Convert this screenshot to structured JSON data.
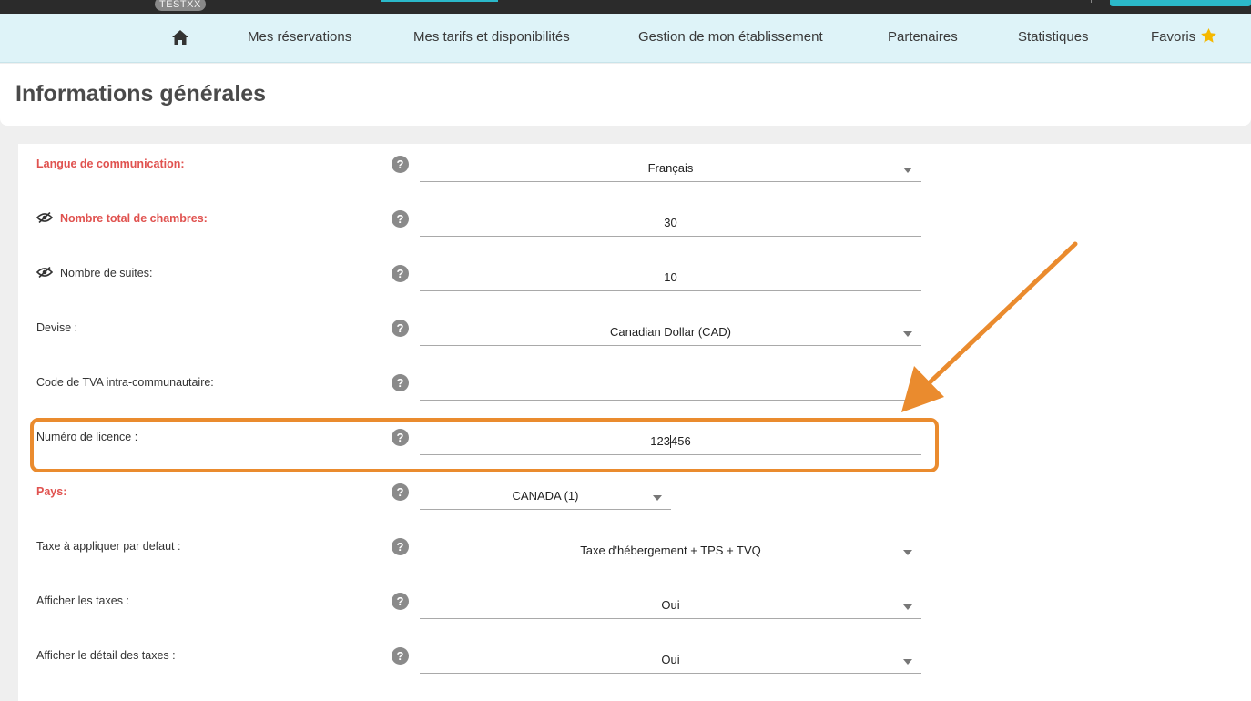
{
  "topbar": {
    "badge": "TESTXX"
  },
  "nav": {
    "items": [
      {
        "label": "Mes réservations"
      },
      {
        "label": "Mes tarifs et disponibilités"
      },
      {
        "label": "Gestion de mon établissement"
      },
      {
        "label": "Partenaires"
      },
      {
        "label": "Statistiques"
      },
      {
        "label": "Favoris"
      }
    ]
  },
  "page": {
    "title": "Informations générales"
  },
  "form": {
    "rows": [
      {
        "label": "Langue de communication:",
        "value": "Français",
        "required": true,
        "type": "select"
      },
      {
        "label": "Nombre total de chambres:",
        "value": "30",
        "required": true,
        "type": "input",
        "eye": true
      },
      {
        "label": "Nombre de suites:",
        "value": "10",
        "required": false,
        "type": "input",
        "eye": true
      },
      {
        "label": "Devise :",
        "value": "Canadian Dollar (CAD)",
        "required": false,
        "type": "select"
      },
      {
        "label": "Code de TVA intra-communautaire:",
        "value": "",
        "required": false,
        "type": "input"
      },
      {
        "label": "Numéro de licence :",
        "value_before_cursor": "123",
        "value_after_cursor": "456",
        "required": false,
        "type": "input",
        "highlighted": true
      },
      {
        "label": "Pays:",
        "value": "CANADA (1)",
        "required": true,
        "type": "select"
      },
      {
        "label": "Taxe à appliquer par defaut :",
        "value": "Taxe d'hébergement + TPS + TVQ",
        "required": false,
        "type": "select"
      },
      {
        "label": "Afficher les taxes :",
        "value": "Oui",
        "required": false,
        "type": "select"
      },
      {
        "label": "Afficher le détail des taxes :",
        "value": "Oui",
        "required": false,
        "type": "select"
      }
    ],
    "help_symbol": "?"
  },
  "colors": {
    "accent": "#2bb8c9",
    "required_label": "#e0524f",
    "annotation": "#ea8b2e",
    "nav_bg": "#def3f8",
    "star": "#f5b800"
  },
  "icons": {
    "home": "home-icon",
    "favorite": "star-icon",
    "visibility": "eye-slash-icon",
    "help": "help-icon",
    "dropdown": "caret-down-icon"
  }
}
